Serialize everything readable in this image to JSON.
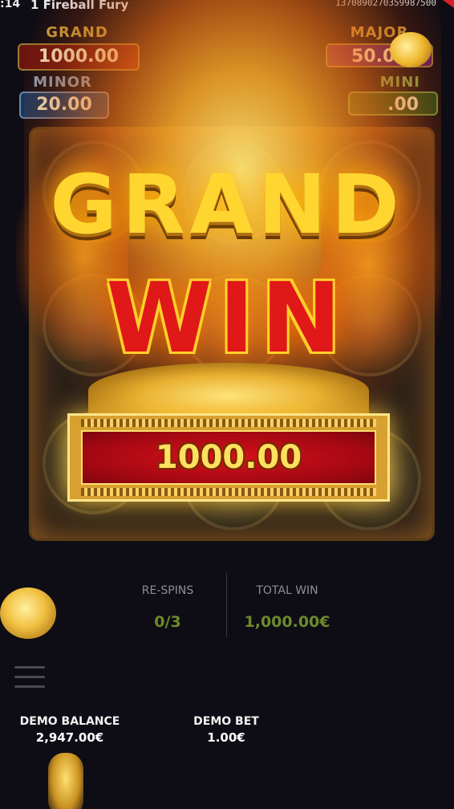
{
  "topbar": {
    "clock": ":14",
    "title": "1 Fireball Fury",
    "round_id": "13708902703599875​00"
  },
  "jackpots": {
    "grand": {
      "label": "GRAND",
      "value": "1000.00"
    },
    "major": {
      "label": "MAJOR",
      "value": "50.0"
    },
    "minor": {
      "label": "MINOR",
      "value": "20.00"
    },
    "mini": {
      "label": "MINI",
      "value": ".00"
    }
  },
  "win_overlay": {
    "line1": "GRAND",
    "line2": "WIN",
    "amount": "1000.00"
  },
  "stats": {
    "respins_label": "RE-SPINS",
    "respins_value": "0/3",
    "total_win_label": "TOTAL WIN",
    "total_win_value": "1,000.00€"
  },
  "footer": {
    "balance_label": "DEMO BALANCE",
    "balance_value": "2,947.00€",
    "bet_label": "DEMO BET",
    "bet_value": "1.00€"
  },
  "colors": {
    "gold": "#ffd630",
    "win_red": "#e01818",
    "stat_green": "#6e8a2a",
    "banner_red": "#a20812"
  },
  "icons": [
    "menu-icon",
    "coin-icon"
  ]
}
